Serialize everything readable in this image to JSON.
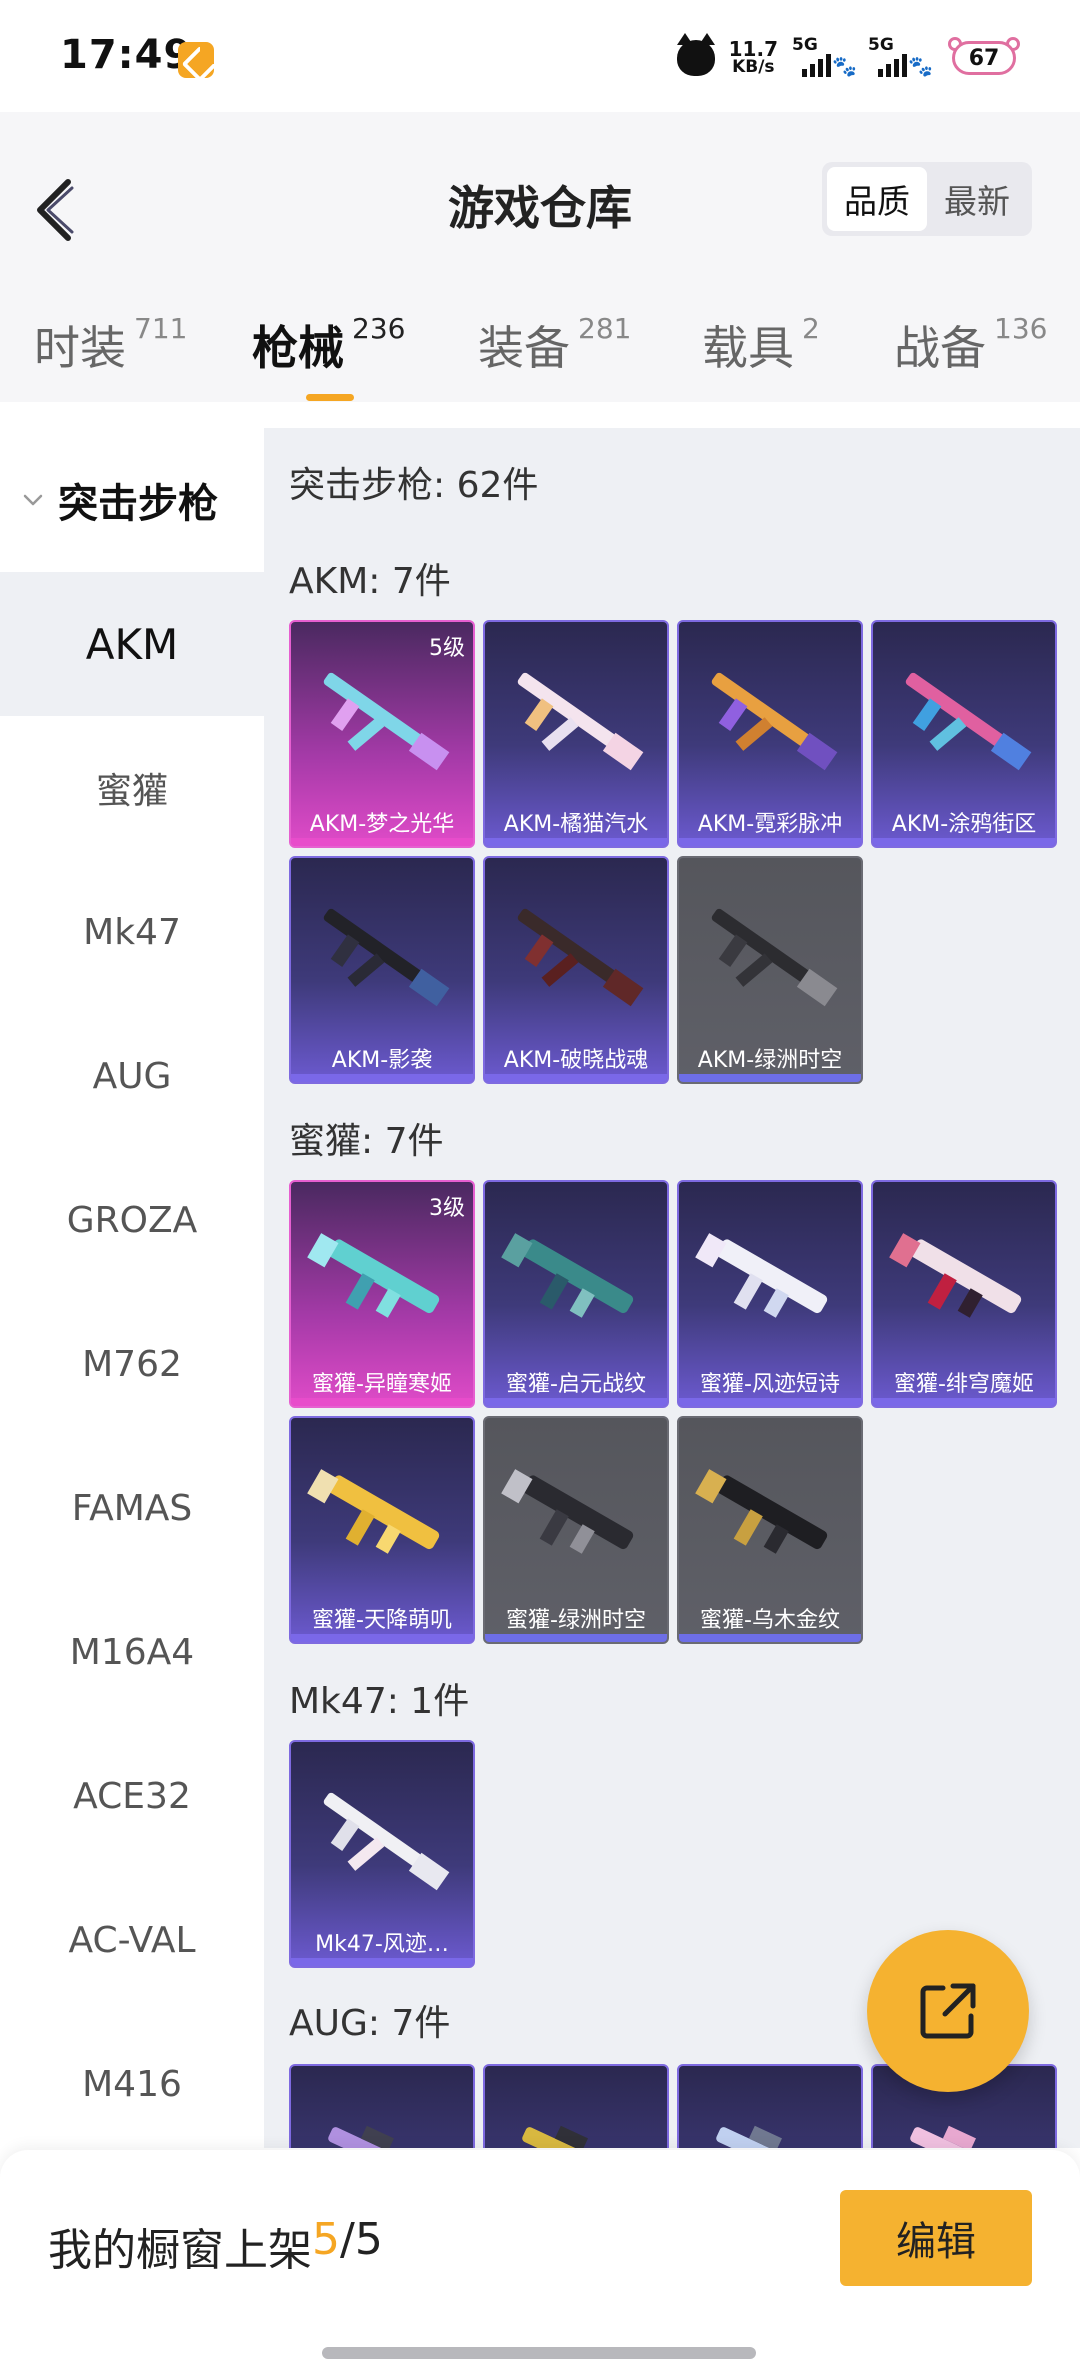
{
  "status_bar": {
    "time": "17:49",
    "net_speed_value": "11.7",
    "net_speed_unit": "KB/s",
    "sim1_label": "5G",
    "sim2_label": "5G",
    "battery": "67"
  },
  "header": {
    "title": "游戏仓库",
    "sort_options": [
      "品质",
      "最新"
    ],
    "active_sort": "品质"
  },
  "tabs": [
    {
      "label": "时装",
      "count": "711"
    },
    {
      "label": "枪械",
      "count": "236",
      "active": true
    },
    {
      "label": "装备",
      "count": "281"
    },
    {
      "label": "载具",
      "count": "2"
    },
    {
      "label": "战备",
      "count": "136"
    }
  ],
  "sidebar": {
    "group": "突击步枪",
    "items": [
      "AKM",
      "蜜獾",
      "Mk47",
      "AUG",
      "GROZA",
      "M762",
      "FAMAS",
      "M16A4",
      "ACE32",
      "AC-VAL",
      "M416"
    ],
    "active": "AKM"
  },
  "content": {
    "category_title": "突击步枪: 62件",
    "sections": [
      {
        "title": "AKM: 7件",
        "items": [
          {
            "name": "AKM-梦之光华",
            "rarity": "pink",
            "level": "5级"
          },
          {
            "name": "AKM-橘猫汽水",
            "rarity": "purple"
          },
          {
            "name": "AKM-霓彩脉冲",
            "rarity": "purple"
          },
          {
            "name": "AKM-涂鸦街区",
            "rarity": "purple"
          },
          {
            "name": "AKM-影袭",
            "rarity": "purple"
          },
          {
            "name": "AKM-破晓战魂",
            "rarity": "purple"
          },
          {
            "name": "AKM-绿洲时空",
            "rarity": "gray"
          }
        ]
      },
      {
        "title": "蜜獾: 7件",
        "items": [
          {
            "name": "蜜獾-异瞳寒姬",
            "rarity": "pink",
            "level": "3级"
          },
          {
            "name": "蜜獾-启元战纹",
            "rarity": "purple"
          },
          {
            "name": "蜜獾-风迹短诗",
            "rarity": "purple"
          },
          {
            "name": "蜜獾-绯穹魔姬",
            "rarity": "purple"
          },
          {
            "name": "蜜獾-天降萌叽",
            "rarity": "purple"
          },
          {
            "name": "蜜獾-绿洲时空",
            "rarity": "gray"
          },
          {
            "name": "蜜獾-乌木金纹",
            "rarity": "gray"
          }
        ]
      },
      {
        "title": "Mk47: 1件",
        "items": [
          {
            "name": "Mk47-风迹…",
            "rarity": "purple"
          }
        ]
      },
      {
        "title": "AUG: 7件",
        "items": [
          {
            "name": "",
            "rarity": "purple"
          },
          {
            "name": "",
            "rarity": "purple"
          },
          {
            "name": "",
            "rarity": "purple"
          },
          {
            "name": "",
            "rarity": "purple"
          }
        ]
      }
    ]
  },
  "bottom": {
    "shelf_label": "我的橱窗上架",
    "shelf_current": "5",
    "shelf_total": "/5",
    "edit_label": "编辑"
  },
  "colors": {
    "accent": "#f5a623",
    "content_bg": "#eef0f4",
    "purple_card": "#3e3a7a",
    "pink_card": "#a53aa8",
    "gray_card": "#5f6068"
  }
}
